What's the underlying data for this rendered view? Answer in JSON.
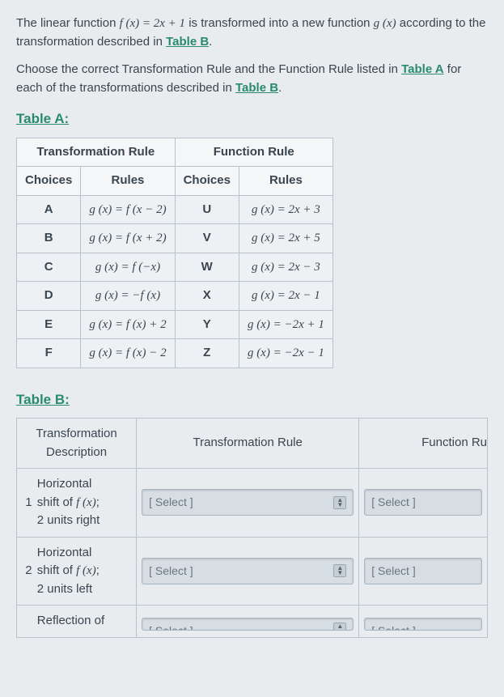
{
  "intro": {
    "p1_a": "The linear function ",
    "p1_fx": "f (x) = 2x + 1",
    "p1_b": " is transformed into a new function ",
    "p1_gx": "g (x)",
    "p1_c": " according to the transformation described in ",
    "p1_link": "Table B",
    "p1_d": ".",
    "p2_a": "Choose the correct Transformation Rule and the Function Rule listed in ",
    "p2_link": "Table A",
    "p2_b": " for each of the transformations described in ",
    "p2_link2": "Table B",
    "p2_c": "."
  },
  "tableA": {
    "heading": "Table A:",
    "header_tr": "Transformation Rule",
    "header_fr": "Function Rule",
    "sub_choices": "Choices",
    "sub_rules": "Rules",
    "rows": [
      {
        "c1": "A",
        "r1": "g (x) = f (x − 2)",
        "c2": "U",
        "r2": "g (x) = 2x + 3"
      },
      {
        "c1": "B",
        "r1": "g (x) = f (x + 2)",
        "c2": "V",
        "r2": "g (x) = 2x + 5"
      },
      {
        "c1": "C",
        "r1": "g (x) = f (−x)",
        "c2": "W",
        "r2": "g (x) = 2x − 3"
      },
      {
        "c1": "D",
        "r1": "g (x) = −f (x)",
        "c2": "X",
        "r2": "g (x) = 2x − 1"
      },
      {
        "c1": "E",
        "r1": "g (x) = f (x) + 2",
        "c2": "Y",
        "r2": "g (x) = −2x + 1"
      },
      {
        "c1": "F",
        "r1": "g (x) = f (x) − 2",
        "c2": "Z",
        "r2": "g (x) = −2x − 1"
      }
    ]
  },
  "tableB": {
    "heading": "Table B:",
    "header_desc": "Transformation Description",
    "header_tr": "Transformation Rule",
    "header_fr": "Function Ru",
    "select_placeholder": "[ Select ]",
    "rows": [
      {
        "n": "1",
        "desc_a": "Horizontal",
        "desc_b": "shift of ",
        "desc_fx": "f (x)",
        "desc_c": ";",
        "desc_d": "2 units right"
      },
      {
        "n": "2",
        "desc_a": "Horizontal",
        "desc_b": "shift of ",
        "desc_fx": "f (x)",
        "desc_c": ";",
        "desc_d": "2 units left"
      },
      {
        "n": "",
        "desc_a": "Reflection of",
        "desc_b": "",
        "desc_fx": "",
        "desc_c": "",
        "desc_d": ""
      }
    ]
  }
}
